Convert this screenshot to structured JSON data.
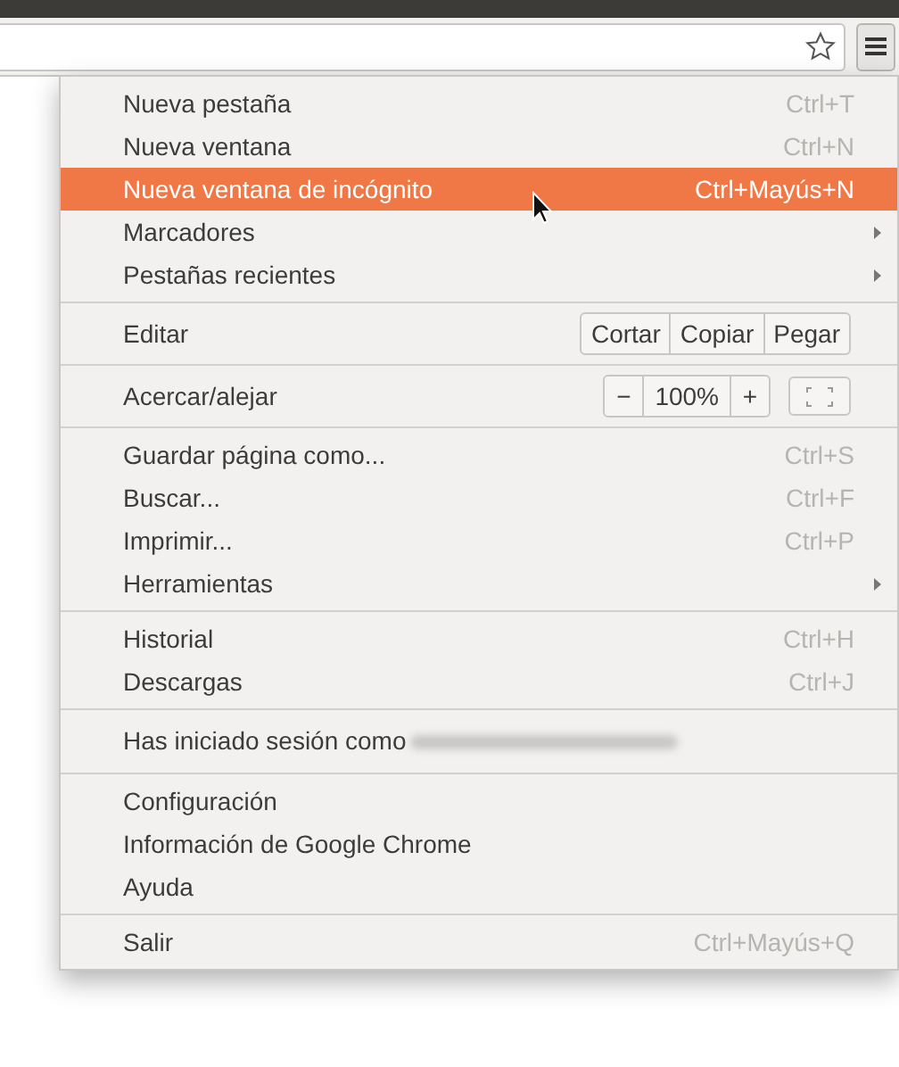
{
  "menu": {
    "sections": [
      {
        "kind": "items",
        "items": [
          {
            "label": "Nueva pestaña",
            "shortcut": "Ctrl+T",
            "submenu": false,
            "selected": false
          },
          {
            "label": "Nueva ventana",
            "shortcut": "Ctrl+N",
            "submenu": false,
            "selected": false
          },
          {
            "label": "Nueva ventana de incógnito",
            "shortcut": "Ctrl+Mayús+N",
            "submenu": false,
            "selected": true
          },
          {
            "label": "Marcadores",
            "submenu": true,
            "selected": false
          },
          {
            "label": "Pestañas recientes",
            "submenu": true,
            "selected": false
          }
        ]
      },
      {
        "kind": "edit",
        "label": "Editar",
        "buttons": [
          "Cortar",
          "Copiar",
          "Pegar"
        ]
      },
      {
        "kind": "zoom",
        "label": "Acercar/alejar",
        "minus": "−",
        "value": "100%",
        "plus": "+"
      },
      {
        "kind": "items",
        "items": [
          {
            "label": "Guardar página como...",
            "shortcut": "Ctrl+S",
            "submenu": false,
            "selected": false
          },
          {
            "label": "Buscar...",
            "shortcut": "Ctrl+F",
            "submenu": false,
            "selected": false
          },
          {
            "label": "Imprimir...",
            "shortcut": "Ctrl+P",
            "submenu": false,
            "selected": false
          },
          {
            "label": "Herramientas",
            "submenu": true,
            "selected": false
          }
        ]
      },
      {
        "kind": "items",
        "items": [
          {
            "label": "Historial",
            "shortcut": "Ctrl+H",
            "submenu": false,
            "selected": false
          },
          {
            "label": "Descargas",
            "shortcut": "Ctrl+J",
            "submenu": false,
            "selected": false
          }
        ]
      },
      {
        "kind": "account",
        "label": "Has iniciado sesión como",
        "redacted": true
      },
      {
        "kind": "items",
        "items": [
          {
            "label": "Configuración",
            "submenu": false,
            "selected": false
          },
          {
            "label": "Información de Google Chrome",
            "submenu": false,
            "selected": false
          },
          {
            "label": "Ayuda",
            "submenu": false,
            "selected": false
          }
        ]
      },
      {
        "kind": "items",
        "items": [
          {
            "label": "Salir",
            "shortcut": "Ctrl+Mayús+Q",
            "submenu": false,
            "selected": false
          }
        ]
      }
    ]
  }
}
